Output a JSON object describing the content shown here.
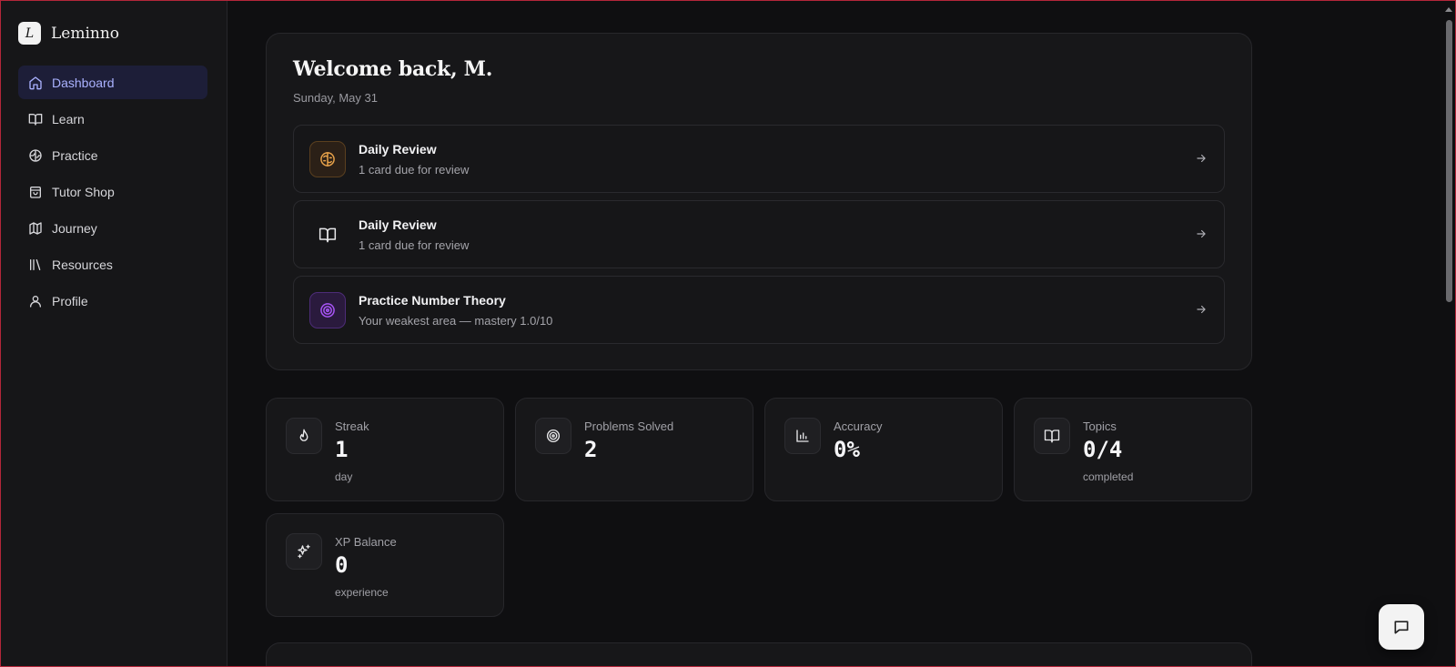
{
  "brand": {
    "logo_letter": "L",
    "name": "Leminno"
  },
  "sidebar": {
    "items": [
      {
        "label": "Dashboard",
        "icon": "home-icon",
        "active": true
      },
      {
        "label": "Learn",
        "icon": "book-open-icon",
        "active": false
      },
      {
        "label": "Practice",
        "icon": "brain-icon",
        "active": false
      },
      {
        "label": "Tutor Shop",
        "icon": "shopping-bag-icon",
        "active": false
      },
      {
        "label": "Journey",
        "icon": "map-icon",
        "active": false
      },
      {
        "label": "Resources",
        "icon": "library-icon",
        "active": false
      },
      {
        "label": "Profile",
        "icon": "user-icon",
        "active": false
      }
    ]
  },
  "welcome": {
    "title": "Welcome back, M.",
    "date": "Sunday, May 31",
    "actions": [
      {
        "title": "Daily Review",
        "subtitle": "1 card due for review",
        "icon": "brain-icon",
        "accent": "#e8a24a"
      },
      {
        "title": "Daily Review",
        "subtitle": "1 card due for review",
        "icon": "book-open-icon",
        "accent": "#e8e8ea"
      },
      {
        "title": "Practice Number Theory",
        "subtitle": "Your weakest area — mastery 1.0/10",
        "icon": "target-icon",
        "accent": "#a855f7"
      }
    ]
  },
  "stats": [
    {
      "label": "Streak",
      "value": "1",
      "unit": "day",
      "icon": "flame-icon"
    },
    {
      "label": "Problems Solved",
      "value": "2",
      "unit": "",
      "icon": "target-icon"
    },
    {
      "label": "Accuracy",
      "value": "0%",
      "unit": "",
      "icon": "bar-chart-icon"
    },
    {
      "label": "Topics",
      "value": "0/4",
      "unit": "completed",
      "icon": "book-open-icon"
    },
    {
      "label": "XP Balance",
      "value": "0",
      "unit": "experience",
      "icon": "sparkles-icon"
    }
  ],
  "colors": {
    "active_nav_bg": "#1d1e38",
    "active_nav_text": "#aab2ff",
    "background": "#0f0f11"
  }
}
